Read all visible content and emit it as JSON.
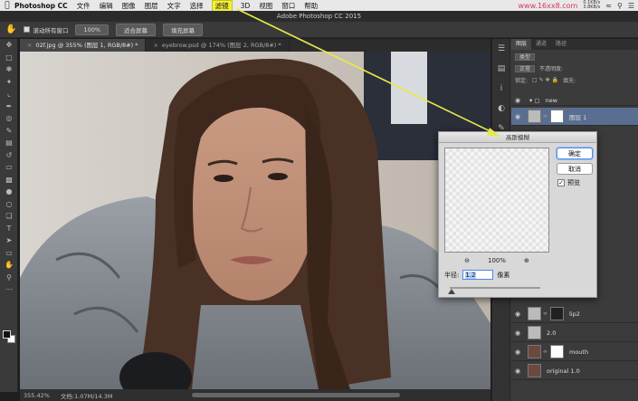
{
  "menubar": {
    "apple": "",
    "app": "Photoshop CC",
    "items": [
      "文件",
      "编辑",
      "图像",
      "图层",
      "文字",
      "选择",
      "滤镜",
      "3D",
      "视图",
      "窗口",
      "帮助"
    ],
    "highlighted_index": 6,
    "net_up": "0.1KB/s",
    "net_down": "3.8KB/s",
    "watermark": "www.16xx8.com"
  },
  "window": {
    "title": "Adobe Photoshop CC 2015"
  },
  "options": {
    "scroll_all_label": "滚动所有窗口",
    "zoom_value": "100%",
    "fit_screen_label": "适合屏幕",
    "fill_screen_label": "填充屏幕"
  },
  "tabs": [
    {
      "label": "02f.jpg @ 355% (图层 1, RGB/8#) *",
      "active": true
    },
    {
      "label": "eyebrow.psd @ 174% (图层 2, RGB/8#) *",
      "active": false
    }
  ],
  "status": {
    "zoom": "355.42%",
    "doc": "文档:1.07M/14.3M"
  },
  "layers_panel": {
    "tabs": [
      "图层",
      "通道",
      "路径"
    ],
    "kind_label": "类型",
    "blend_mode": "正常",
    "opacity_label": "不透明度:",
    "lock_label": "锁定:",
    "fill_label": "填充:",
    "layers": [
      {
        "name": "new",
        "selected": false,
        "group": true
      },
      {
        "name": "图层 1",
        "selected": true
      },
      {
        "name": "lip2",
        "selected": false
      },
      {
        "name": "2.0",
        "selected": false
      },
      {
        "name": "mouth",
        "selected": false
      },
      {
        "name": "original 1.0",
        "selected": false
      }
    ]
  },
  "dialog": {
    "title": "高斯模糊",
    "ok_label": "确定",
    "cancel_label": "取消",
    "preview_label": "预览",
    "preview_checked": true,
    "zoom_value": "100%",
    "radius_label": "半径:",
    "radius_value": "1.2",
    "unit_label": "像素",
    "radius_slider_fraction": 0.02
  },
  "colors": {
    "highlight": "#f2ef3a",
    "selected_layer": "#5a6e91",
    "arrow": "#e8e84a"
  }
}
